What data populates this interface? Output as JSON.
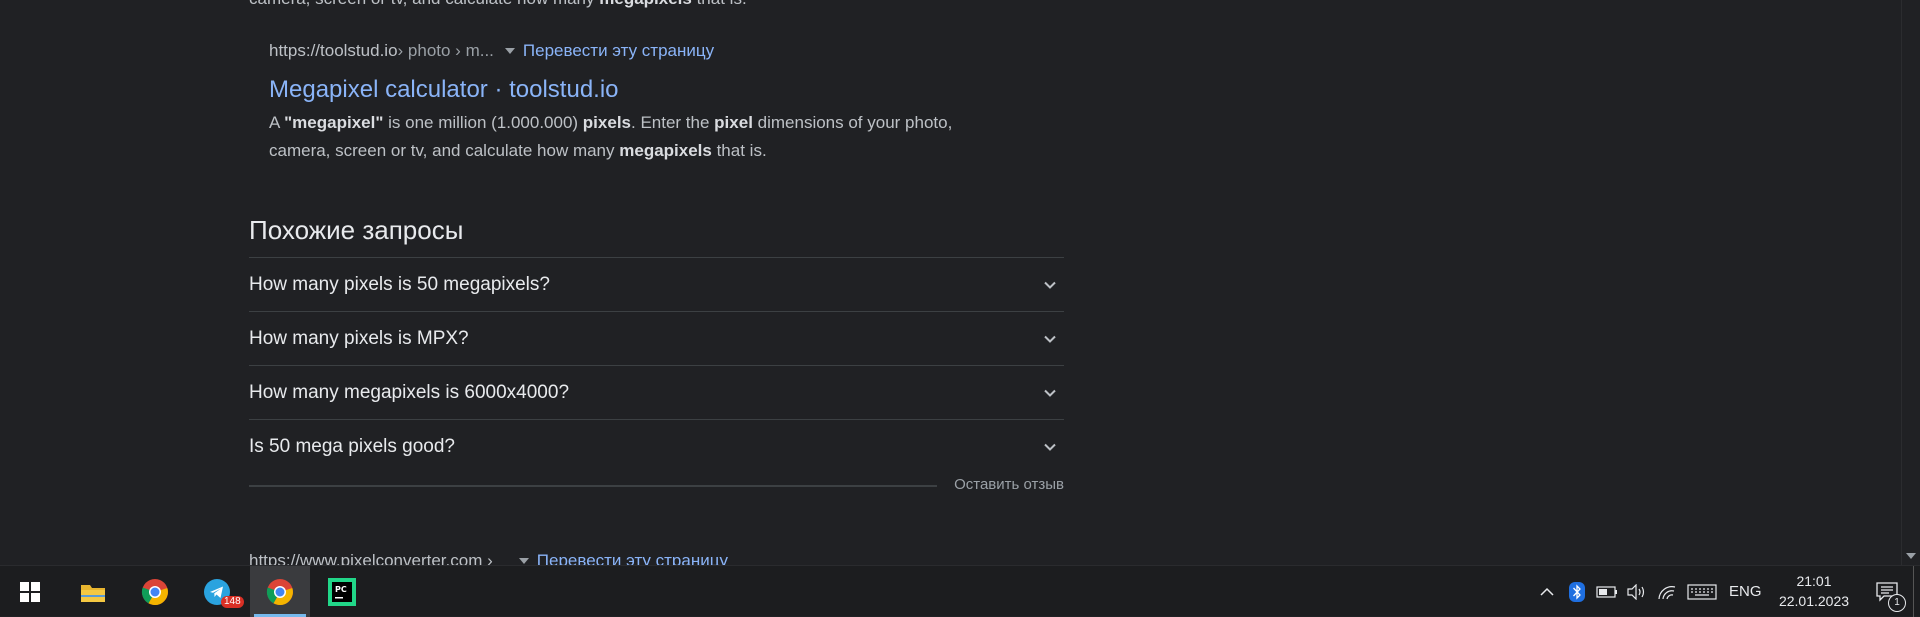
{
  "previous_snippet": {
    "p1": "camera, screen or tv, and calculate how many ",
    "b1": "megapixels",
    "p2": " that is."
  },
  "result": {
    "url": "https://toolstud.io",
    "path": " › photo › m...",
    "translate": "Перевести эту страницу",
    "title": "Megapixel calculator · toolstud.io",
    "snippet": {
      "p1": "A ",
      "b1": "\"megapixel\"",
      "p2": " is one million (1.000.000) ",
      "b2": "pixels",
      "p3": ". Enter the ",
      "b3": "pixel",
      "p4": " dimensions of your photo,",
      "p5": "camera, screen or tv, and calculate how many ",
      "b4": "megapixels",
      "p6": " that is."
    }
  },
  "related": {
    "heading": "Похожие запросы",
    "items": [
      "How many pixels is 50 megapixels?",
      "How many pixels is MPX?",
      "How many megapixels is 6000x4000?",
      "Is 50 mega pixels good?"
    ],
    "feedback": "Оставить отзыв"
  },
  "next_result": {
    "url": "https://www.pixelconverter.com ›",
    "translate": "Перевести эту страницу"
  },
  "taskbar": {
    "telegram_badge": "148",
    "language": "ENG",
    "time": "21:01",
    "date": "22.01.2023",
    "notifications": "1",
    "colors": {
      "accent": "#76b9ed",
      "link": "#8ab4f8",
      "background": "#202124"
    }
  }
}
